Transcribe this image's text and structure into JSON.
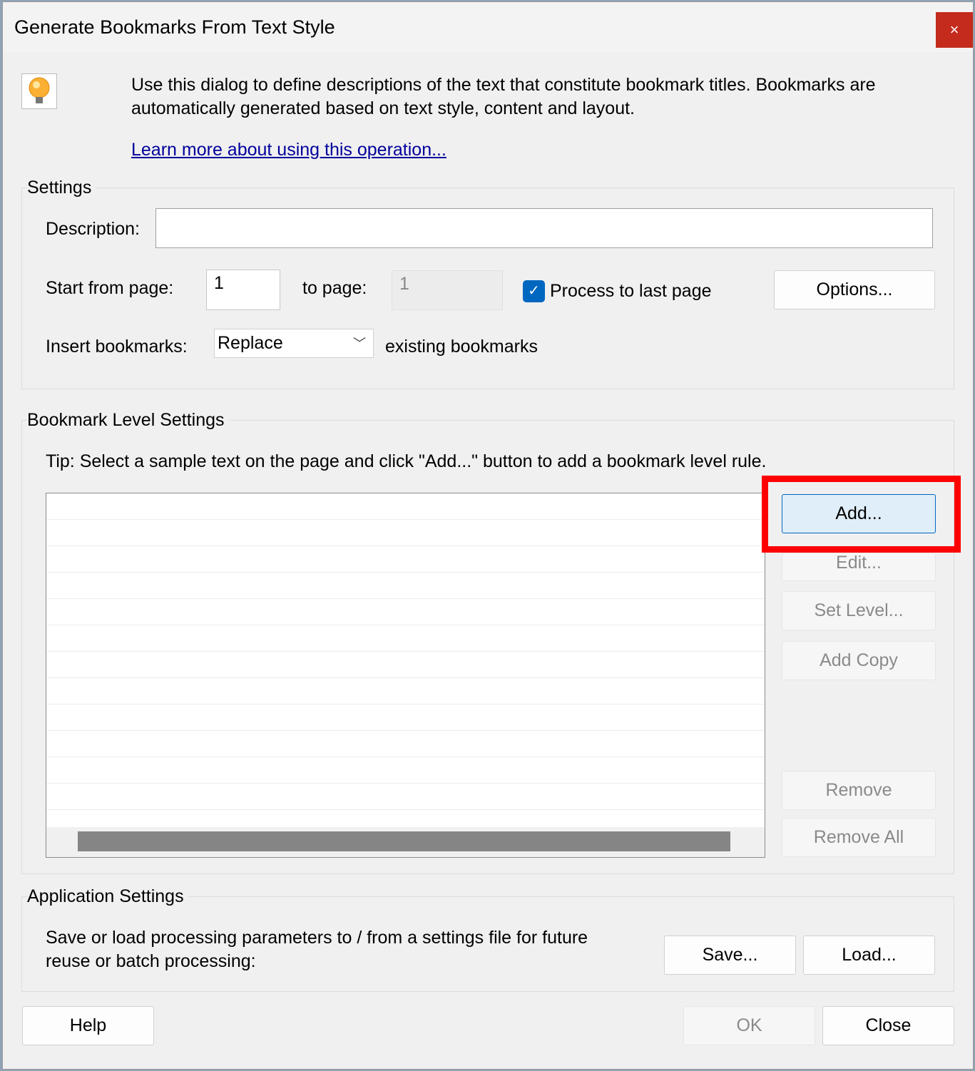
{
  "window": {
    "title": "Generate Bookmarks From Text Style",
    "close_label": "×"
  },
  "intro": {
    "icon": "lightbulb-icon",
    "text_line1": "Use this dialog to define descriptions of the text that constitute bookmark titles. Bookmarks are",
    "text_line2": "automatically generated based on text style, content and layout.",
    "link": "Learn more about using this operation..."
  },
  "settings": {
    "heading": "Settings",
    "description_label": "Description:",
    "description_value": "",
    "start_label": "Start from page:",
    "start_value": "1",
    "to_label": "to page:",
    "to_value": "1",
    "process_last_label": "Process to last page",
    "process_last_checked": true,
    "options_label": "Options...",
    "insert_label": "Insert bookmarks:",
    "insert_value": "Replace",
    "insert_suffix": "existing bookmarks"
  },
  "levels": {
    "heading": "Bookmark Level Settings",
    "tip": "Tip: Select a sample text on the page and click \"Add...\" button to add a bookmark level rule.",
    "rules": [],
    "add": "Add...",
    "edit": "Edit...",
    "set_level": "Set Level...",
    "add_copy": "Add Copy",
    "remove": "Remove",
    "remove_all": "Remove All"
  },
  "app_settings": {
    "heading": "Application Settings",
    "text_line1": "Save or load processing parameters to / from a settings file for future",
    "text_line2": "reuse or batch processing:",
    "save": "Save...",
    "load": "Load..."
  },
  "footer": {
    "help": "Help",
    "ok": "OK",
    "close": "Close"
  },
  "colors": {
    "accent": "#0067c0",
    "highlight": "#ff0000",
    "link": "#00009c"
  }
}
